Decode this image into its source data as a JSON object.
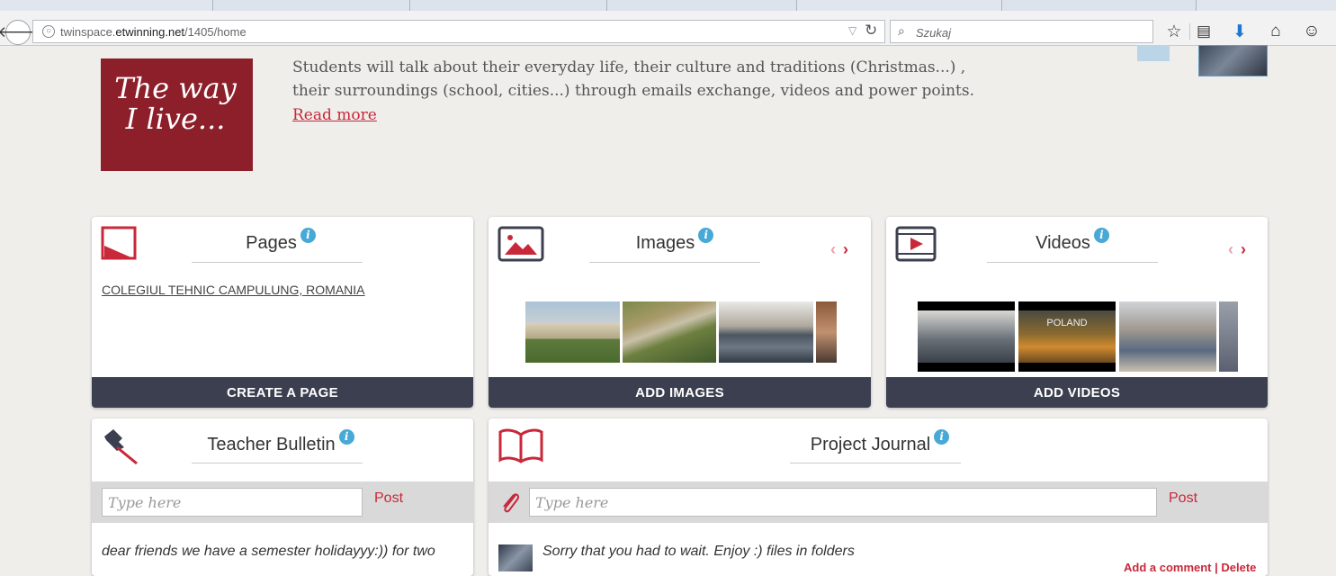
{
  "browser": {
    "url_prefix": "twinspace.",
    "url_domain": "etwinning.net",
    "url_path": "/1405/home",
    "search_placeholder": "Szukaj"
  },
  "project": {
    "logo_text": "The way I live...",
    "description": "Students will talk about their everyday life, their culture and traditions (Christmas...) , their surroundings (school, cities...) through emails exchange, videos and power points.",
    "read_more": "Read more"
  },
  "pages": {
    "title": "Pages",
    "link": "COLEGIUL TEHNIC CAMPULUNG, ROMANIA",
    "button": "CREATE A PAGE"
  },
  "images": {
    "title": "Images",
    "button": "ADD IMAGES",
    "thumbnails": [
      "school-building",
      "aerial-view",
      "group-photo",
      "partial-photo"
    ]
  },
  "videos": {
    "title": "Videos",
    "button": "ADD VIDEOS",
    "thumbnails": [
      "class-group-video",
      "poland-landscape-video",
      "classroom-video",
      "partial-video"
    ],
    "poland_caption": "POLAND"
  },
  "teacher_bulletin": {
    "title": "Teacher Bulletin",
    "input_placeholder": "Type here",
    "post_label": "Post",
    "entry_text": "dear friends we have a semester holidayyy:)) for two"
  },
  "project_journal": {
    "title": "Project Journal",
    "input_placeholder": "Type here",
    "post_label": "Post",
    "entry_text": "Sorry that you had to wait. Enjoy :) files in folders",
    "actions": "Add a comment | Delete"
  },
  "colors": {
    "accent": "#c8283a",
    "button_bg": "#3c3f4f",
    "logo_bg": "#8c1f2a",
    "info": "#48a8d6"
  }
}
